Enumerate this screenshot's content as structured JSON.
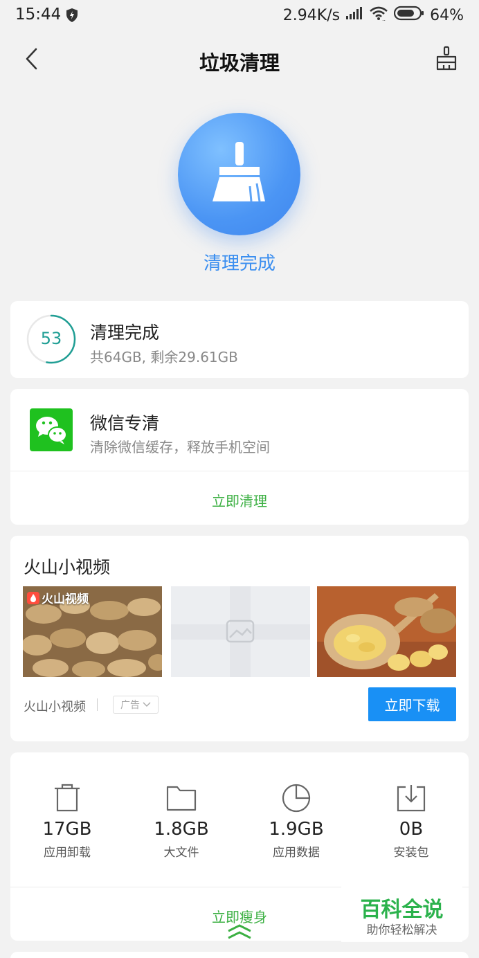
{
  "status_bar": {
    "time": "15:44",
    "net_speed": "2.94K/s",
    "battery": "64%"
  },
  "header": {
    "title": "垃圾清理"
  },
  "hero": {
    "status": "清理完成"
  },
  "storage_card": {
    "score": "53",
    "score_fraction": 0.53,
    "title": "清理完成",
    "detail": "共64GB, 剩余29.61GB"
  },
  "wechat_card": {
    "title": "微信专清",
    "subtitle": "清除微信缓存，释放手机空间",
    "action": "立即清理"
  },
  "ad_card": {
    "title": "火山小视频",
    "thumb_brand": "火山视频",
    "source": "火山小视频",
    "ad_label": "广告",
    "download": "立即下载"
  },
  "slim_card": {
    "stats": [
      {
        "value": "17GB",
        "label": "应用卸载",
        "icon": "trash-icon"
      },
      {
        "value": "1.8GB",
        "label": "大文件",
        "icon": "folder-icon"
      },
      {
        "value": "1.9GB",
        "label": "应用数据",
        "icon": "pie-chart-icon"
      },
      {
        "value": "0B",
        "label": "安装包",
        "icon": "download-box-icon"
      }
    ],
    "action": "立即瘦身"
  },
  "watermark": {
    "brand": "百科全说",
    "slogan": "助你轻松解决"
  },
  "colors": {
    "accent_blue": "#3a8ef0",
    "action_green": "#3cb043",
    "download_blue": "#1990f5",
    "ring_teal": "#1f9e94"
  }
}
